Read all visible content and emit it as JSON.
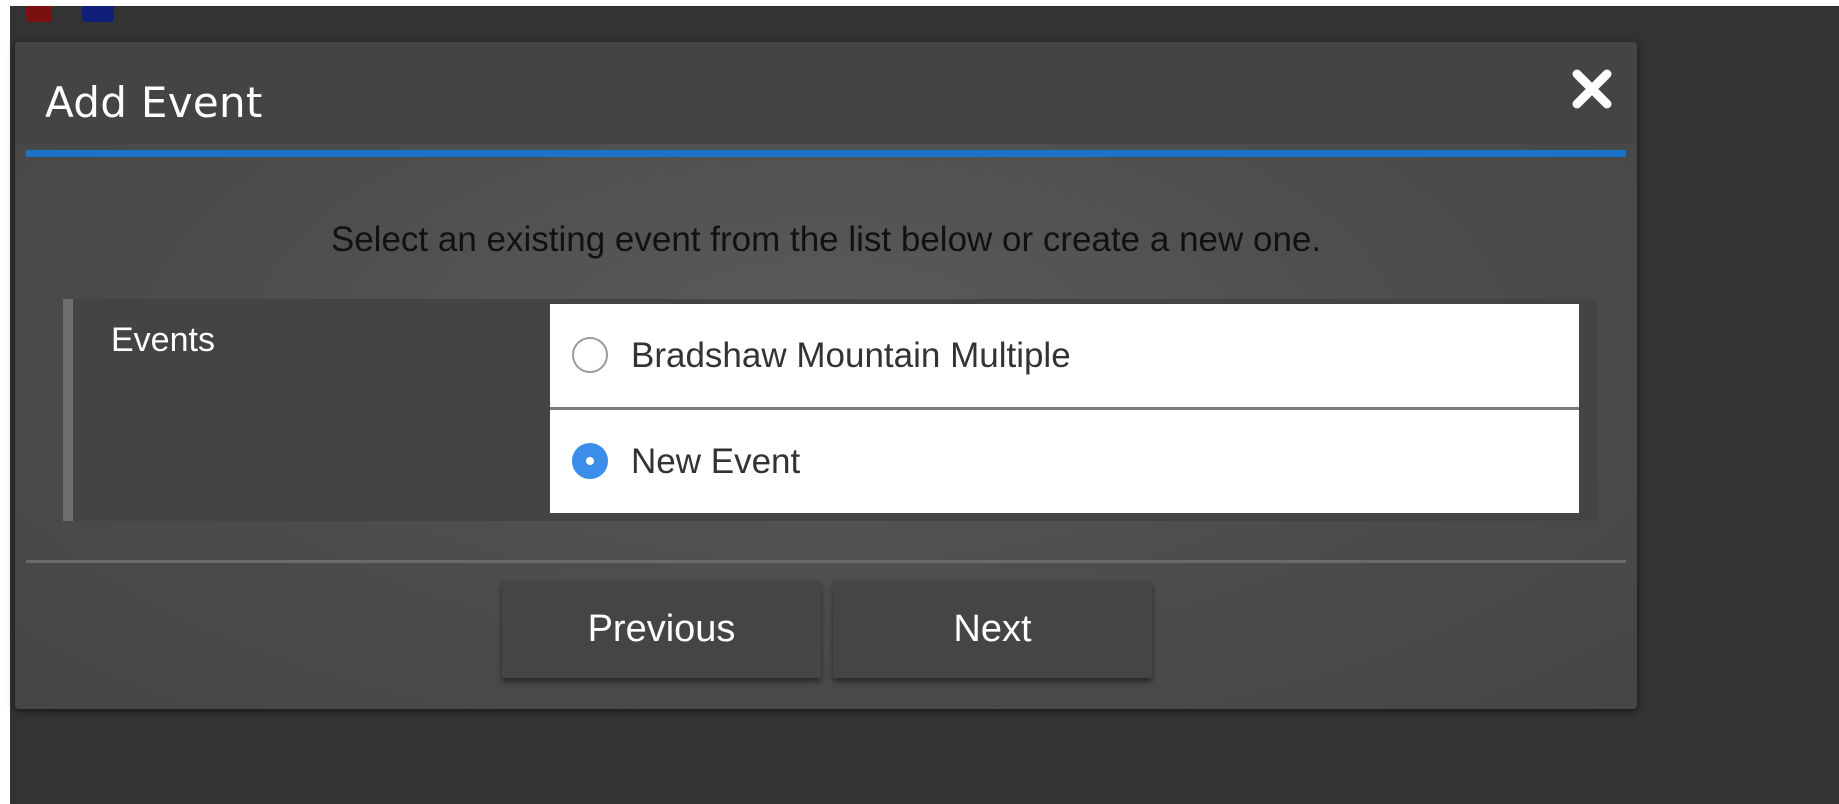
{
  "dialog": {
    "title": "Add Event",
    "close_icon": "close-icon",
    "instruction": "Select an existing event from the list below or create a new one."
  },
  "events_field": {
    "label": "Events",
    "options": [
      {
        "label": "Bradshaw Mountain Multiple",
        "selected": false
      },
      {
        "label": "New Event",
        "selected": true
      }
    ]
  },
  "footer": {
    "previous_label": "Previous",
    "next_label": "Next"
  },
  "colors": {
    "accent": "#1a73c8",
    "radio_selected": "#3a8de8",
    "dialog_header": "#444444",
    "backdrop": "#333333"
  }
}
